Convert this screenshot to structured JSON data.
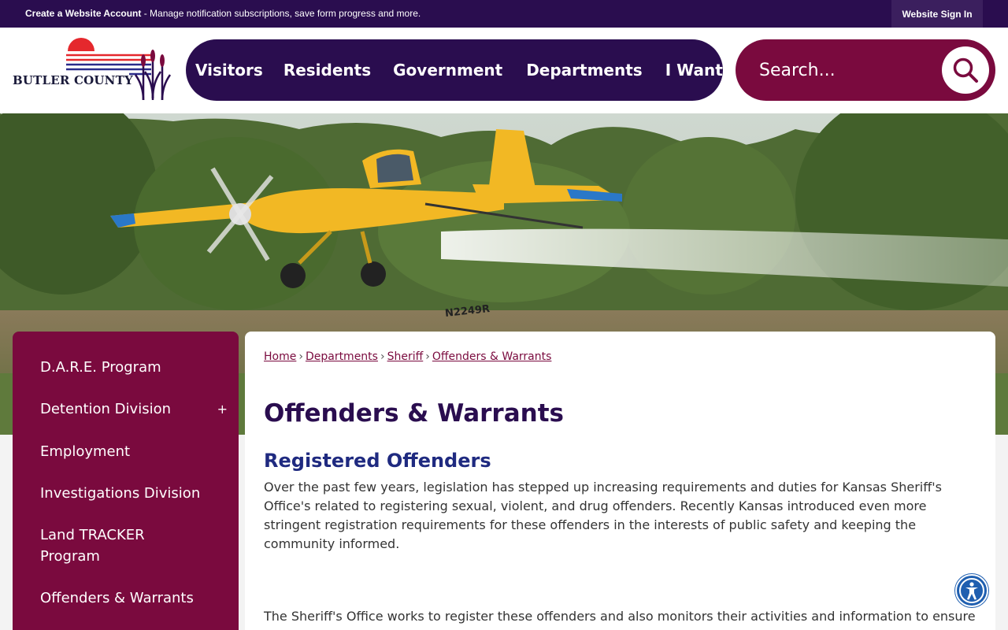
{
  "topbar": {
    "create_account": "Create a Website Account",
    "message": " - Manage notification subscriptions, save form progress and more.",
    "signin_label": "Website Sign In"
  },
  "logo": {
    "text": "BUTLER COUNTY"
  },
  "nav": {
    "items": [
      "Visitors",
      "Residents",
      "Government",
      "Departments",
      "I Want To"
    ]
  },
  "search": {
    "placeholder": "Search..."
  },
  "sidebar": {
    "items": [
      {
        "label": "D.A.R.E. Program"
      },
      {
        "label": "Detention Division",
        "expand": "+"
      },
      {
        "label": "Employment"
      },
      {
        "label": "Investigations Division"
      },
      {
        "label": "Land TRACKER Program"
      },
      {
        "label": "Offenders & Warrants"
      }
    ]
  },
  "breadcrumb": {
    "items": [
      "Home",
      "Departments",
      "Sheriff",
      "Offenders & Warrants"
    ],
    "separator": "›"
  },
  "main": {
    "title": "Offenders & Warrants",
    "section_title": "Registered Offenders",
    "paragraph1": "Over the past few years, legislation has stepped up increasing requirements and duties for Kansas Sheriff's Office's related to registering sexual, violent, and drug offenders. Recently Kansas introduced even more stringent registration requirements for these offenders in the interests of public safety and keeping the community informed.",
    "paragraph2": "The Sheriff's Office works to register these offenders and also monitors their activities and information to ensure"
  },
  "hero": {
    "aircraft_tail": "N2249R"
  },
  "colors": {
    "topbar": "#2a0d4f",
    "nav": "#2a0d4f",
    "brand_maroon": "#7a0a3e",
    "heading_blue": "#1f2a80",
    "accessibility": "#1f5fb0"
  }
}
